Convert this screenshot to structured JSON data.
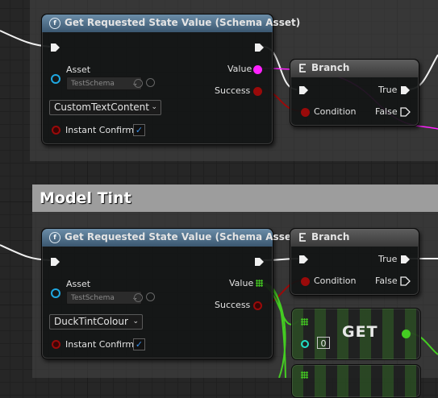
{
  "comment_box": {
    "title": "Model Tint"
  },
  "node1": {
    "title": "Get Requested State Value (Schema Asset)",
    "asset_label": "Asset",
    "asset_value": "TestSchema",
    "value_label": "Value",
    "success_label": "Success",
    "enum_value": "CustomTextContent",
    "instant_confirm_label": "Instant Confirm",
    "checkbox_mark": "✓"
  },
  "branch1": {
    "title": "Branch",
    "true_label": "True",
    "false_label": "False",
    "condition_label": "Condition"
  },
  "node2": {
    "title": "Get Requested State Value (Schema Asset)",
    "asset_label": "Asset",
    "asset_value": "TestSchema",
    "value_label": "Value",
    "success_label": "Success",
    "enum_value": "DuckTintColour",
    "instant_confirm_label": "Instant Confirm",
    "checkbox_mark": "✓"
  },
  "branch2": {
    "title": "Branch",
    "true_label": "True",
    "false_label": "False",
    "condition_label": "Condition"
  },
  "get_node": {
    "label": "GET",
    "index": "0"
  },
  "colors": {
    "exec_wire": "#f0f0f0",
    "text_value_pin": "#ff22ff",
    "bool_pin": "#9a0a0a",
    "object_pin": "#1fa7e0",
    "array_pin": "#44cc22",
    "int_pin": "#22e0c8",
    "function_header": "#4a6d88"
  }
}
